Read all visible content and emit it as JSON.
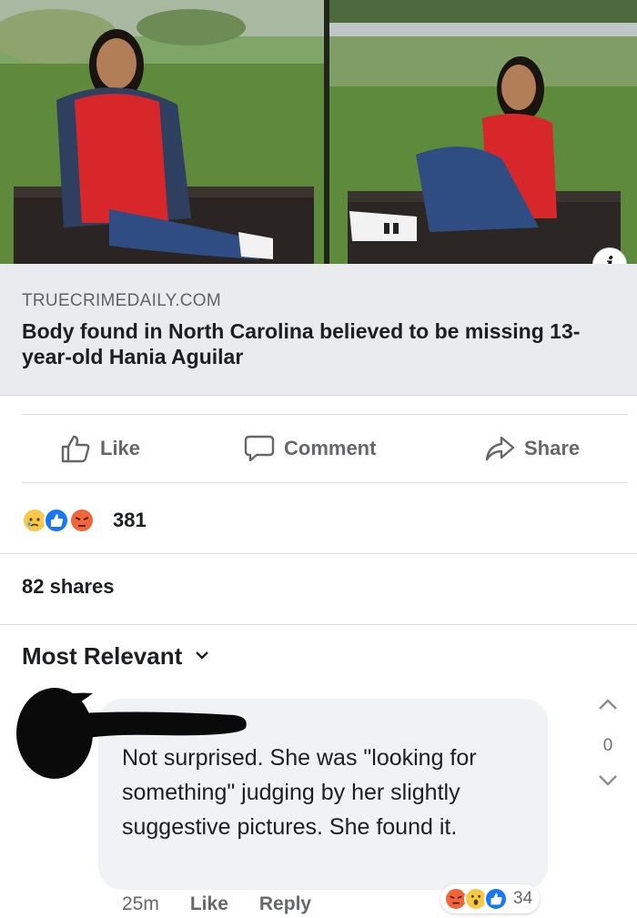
{
  "photos": {
    "left_alt_icon": "photo-left",
    "right_alt_icon": "photo-right"
  },
  "info_badge": "i",
  "link": {
    "domain": "TRUECRIMEDAILY.COM",
    "title": "Body found in North Carolina believed to be missing 13-year-old Hania Aguilar"
  },
  "actions": {
    "like": "Like",
    "comment": "Comment",
    "share": "Share"
  },
  "reactions": {
    "icons": [
      "sad-reaction-icon",
      "like-reaction-icon",
      "angry-reaction-icon"
    ],
    "count": "381"
  },
  "shares": "82 shares",
  "sort": {
    "label": "Most Relevant"
  },
  "votes": {
    "count": "0"
  },
  "comment": {
    "text": "Not surprised. She was \"looking for something\" judging by her slightly suggestive pictures. She found it.",
    "time": "25m",
    "like": "Like",
    "reply": "Reply",
    "reaction_icons": [
      "angry-reaction-icon",
      "wow-reaction-icon",
      "like-reaction-icon"
    ],
    "reaction_count": "34"
  },
  "colors": {
    "link_bg": "#e9ebee",
    "bubble_bg": "#f0f2f5",
    "muted_text": "#65676b",
    "like_blue": "#1877f2",
    "angry_orange": "#f0663a",
    "sad_yellow": "#f7c948"
  }
}
